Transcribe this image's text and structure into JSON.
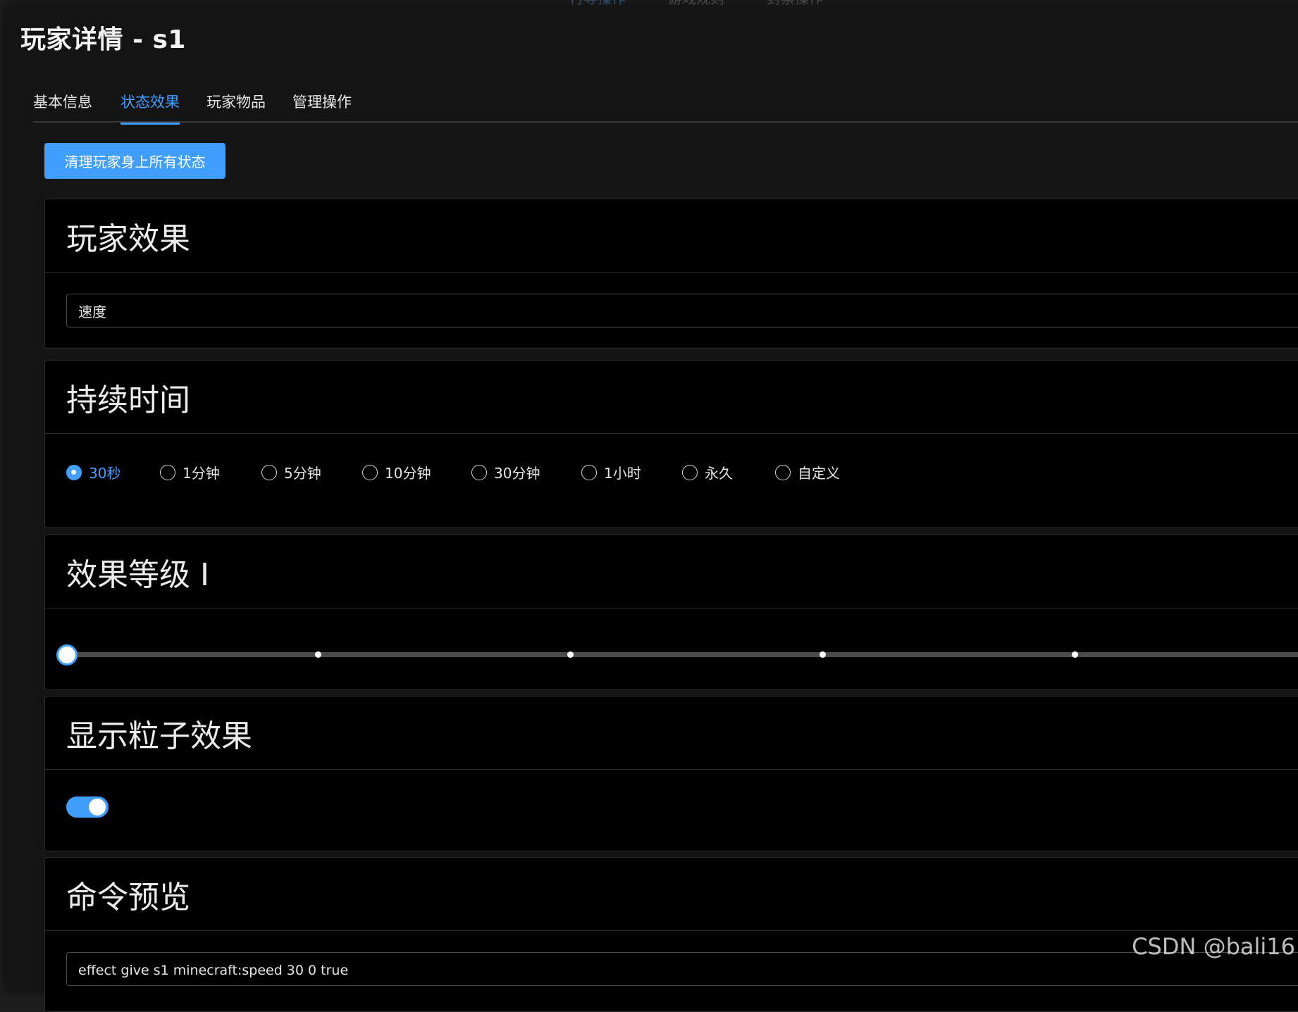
{
  "background_tabs": [
    "行导操作",
    "游戏规则",
    "封禁操作"
  ],
  "dialog": {
    "title": "玩家详情 - s1"
  },
  "tabs": [
    {
      "label": "基本信息",
      "active": false
    },
    {
      "label": "状态效果",
      "active": true
    },
    {
      "label": "玩家物品",
      "active": false
    },
    {
      "label": "管理操作",
      "active": false
    }
  ],
  "clear_button": "清理玩家身上所有状态",
  "effect_card": {
    "title": "玩家效果",
    "selected": "速度"
  },
  "duration_card": {
    "title": "持续时间",
    "options": [
      "30秒",
      "1分钟",
      "5分钟",
      "10分钟",
      "30分钟",
      "1小时",
      "永久",
      "自定义"
    ],
    "selected": "30秒"
  },
  "level_card": {
    "title": "效果等级 I",
    "value": 1
  },
  "particles_card": {
    "title": "显示粒子效果",
    "enabled": true
  },
  "command_card": {
    "title": "命令预览",
    "command": "effect give s1 minecraft:speed 30 0 true"
  },
  "watermark": "CSDN @bali16",
  "colors": {
    "accent": "#409eff",
    "card_bg": "#000000",
    "dialog_bg": "#141414"
  }
}
